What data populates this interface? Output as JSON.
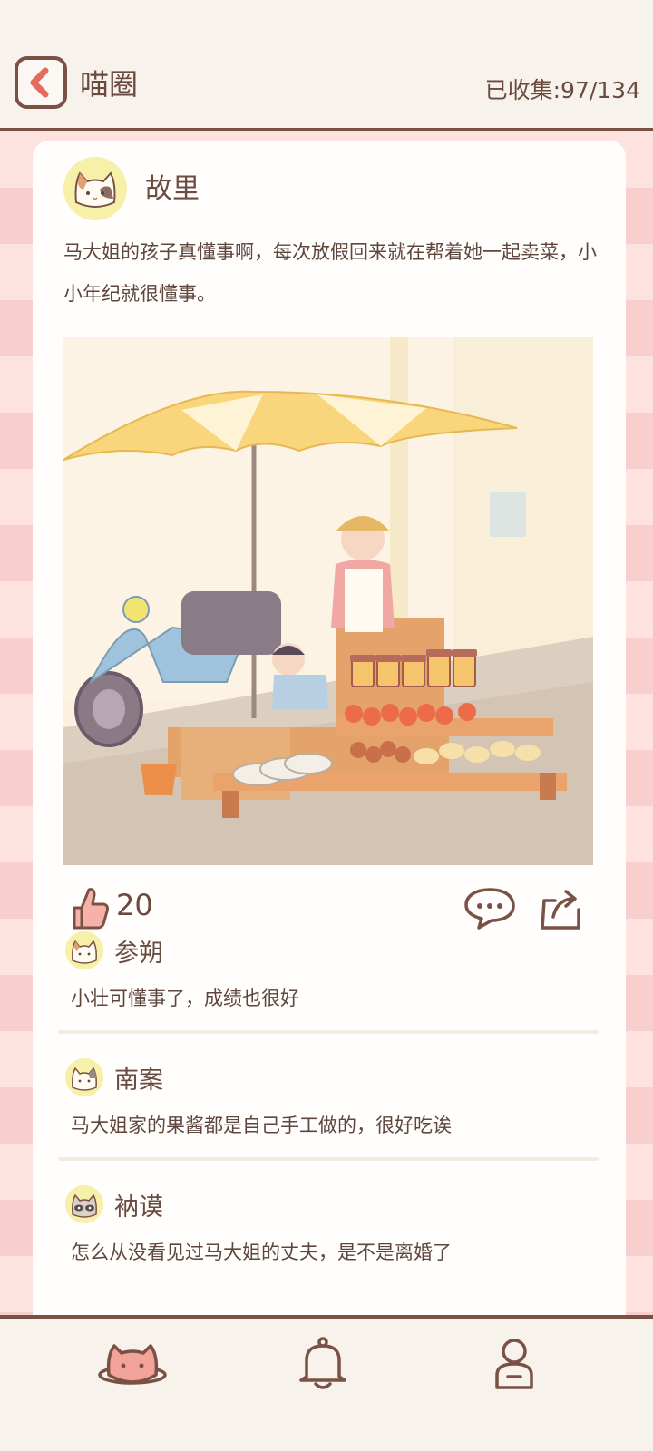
{
  "header": {
    "title": "喵圈",
    "collected_label": "已收集:",
    "collected_value": "97/134"
  },
  "post": {
    "author": "故里",
    "text": "马大姐的孩子真懂事啊，每次放假回来就在帮着她一起卖菜，小小年纪就很懂事。",
    "likes": "20"
  },
  "comments": [
    {
      "name": "参朔",
      "text": "小壮可懂事了，成绩也很好",
      "avatar": "calico-cat-avatar"
    },
    {
      "name": "南案",
      "text": "马大姐家的果酱都是自己手工做的，很好吃诶",
      "avatar": "white-cat-avatar"
    },
    {
      "name": "衲谟",
      "text": "怎么从没看见过马大姐的丈夫，是不是离婚了",
      "avatar": "gray-cat-avatar"
    }
  ],
  "nav": {
    "items": [
      "cat-planet-icon",
      "bell-icon",
      "profile-icon"
    ]
  },
  "colors": {
    "accent": "#e56a5f",
    "brown": "#7a5145",
    "stripe_pink": "#fde2df",
    "avatar_yellow": "#f6f0a8"
  }
}
